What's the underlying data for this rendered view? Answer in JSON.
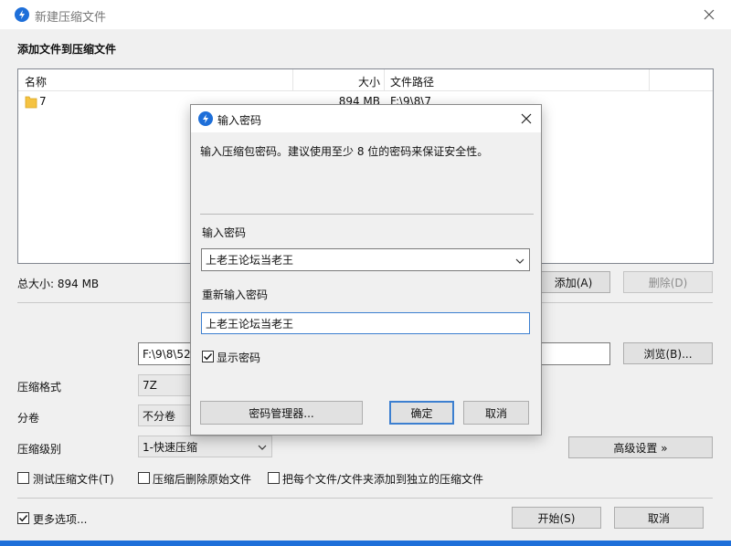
{
  "main_window": {
    "title": "新建压缩文件",
    "section_title": "添加文件到压缩文件",
    "table": {
      "columns": [
        "名称",
        "大小",
        "文件路径"
      ],
      "rows": [
        {
          "name": "7",
          "size": "894 MB",
          "path": "F:\\9\\8\\7"
        }
      ]
    },
    "total_size": "总大小: 894 MB",
    "add_button": "添加(A)",
    "delete_button": "删除(D)",
    "output_path": "F:\\9\\8\\52",
    "browse_button": "浏览(B)...",
    "format_label": "压缩格式",
    "format_value": "7Z",
    "split_label": "分卷",
    "split_value": "不分卷",
    "level_label": "压缩级别",
    "level_value": "1-快速压缩",
    "advanced_button": "高级设置 »",
    "option_test": "测试压缩文件(T)",
    "option_delete": "压缩后删除原始文件",
    "option_each": "把每个文件/文件夹添加到独立的压缩文件",
    "more_options": "更多选项...",
    "start_button": "开始(S)",
    "cancel_button": "取消"
  },
  "dialog": {
    "title": "输入密码",
    "description": "输入压缩包密码。建议使用至少 8 位的密码来保证安全性。",
    "password_label": "输入密码",
    "password_value": "上老王论坛当老王",
    "confirm_label": "重新输入密码",
    "confirm_value": "上老王论坛当老王",
    "show_password": "显示密码",
    "manager_button": "密码管理器...",
    "ok_button": "确定",
    "cancel_button": "取消"
  },
  "colors": {
    "accent": "#1e6fd9",
    "focus_border": "#3c7fd0",
    "folder": "#f5c342"
  }
}
